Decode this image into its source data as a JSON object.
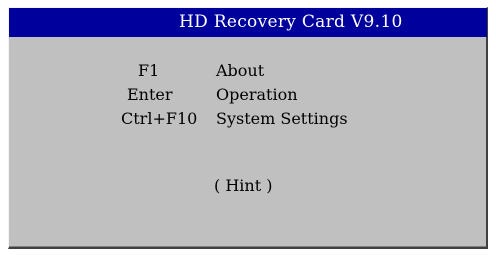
{
  "window": {
    "title": "HD Recovery Card V9.10"
  },
  "menu": {
    "items": [
      {
        "key": "F1",
        "action": "About"
      },
      {
        "key": "Enter",
        "action": "Operation"
      },
      {
        "key": "Ctrl+F10",
        "action": "System Settings"
      }
    ]
  },
  "hint": {
    "label": "( Hint )"
  },
  "colors": {
    "titlebar": "#00009c",
    "title_text": "#ffffff",
    "panel": "#c0c0c0"
  }
}
